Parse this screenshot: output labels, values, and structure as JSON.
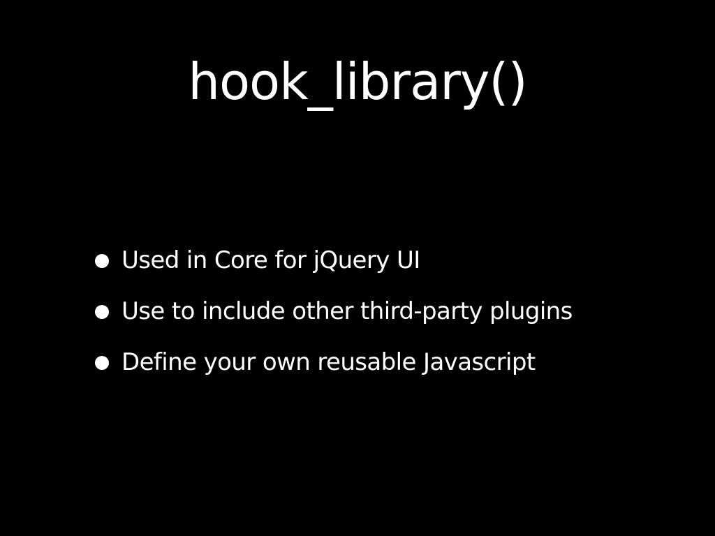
{
  "slide": {
    "title": "hook_library()",
    "bullets": [
      "Used in Core for jQuery UI",
      "Use to include other third-party plugins",
      "Define your own reusable Javascript"
    ]
  },
  "colors": {
    "background": "#000000",
    "text": "#ffffff"
  }
}
